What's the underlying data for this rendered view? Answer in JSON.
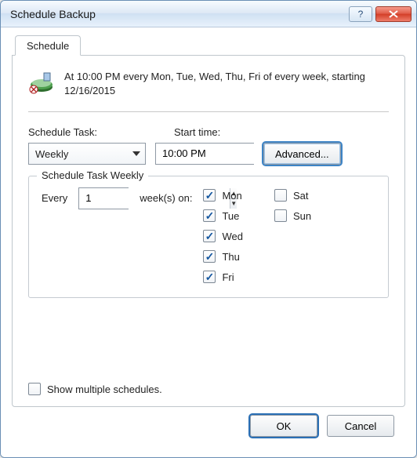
{
  "window": {
    "title": "Schedule Backup"
  },
  "tab": {
    "label": "Schedule"
  },
  "summary": "At 10:00 PM every Mon, Tue, Wed, Thu, Fri of every week, starting 12/16/2015",
  "labels": {
    "schedule_task": "Schedule Task:",
    "start_time": "Start time:",
    "advanced": "Advanced...",
    "group_legend": "Schedule Task Weekly",
    "every": "Every",
    "weeks_on": "week(s) on:",
    "show_multiple": "Show multiple schedules.",
    "ok": "OK",
    "cancel": "Cancel"
  },
  "values": {
    "schedule_task": "Weekly",
    "start_time": "10:00 PM",
    "every_n": "1"
  },
  "days": {
    "mon": {
      "label": "Mon",
      "checked": true
    },
    "tue": {
      "label": "Tue",
      "checked": true
    },
    "wed": {
      "label": "Wed",
      "checked": true
    },
    "thu": {
      "label": "Thu",
      "checked": true
    },
    "fri": {
      "label": "Fri",
      "checked": true
    },
    "sat": {
      "label": "Sat",
      "checked": false
    },
    "sun": {
      "label": "Sun",
      "checked": false
    }
  },
  "show_multiple_checked": false
}
